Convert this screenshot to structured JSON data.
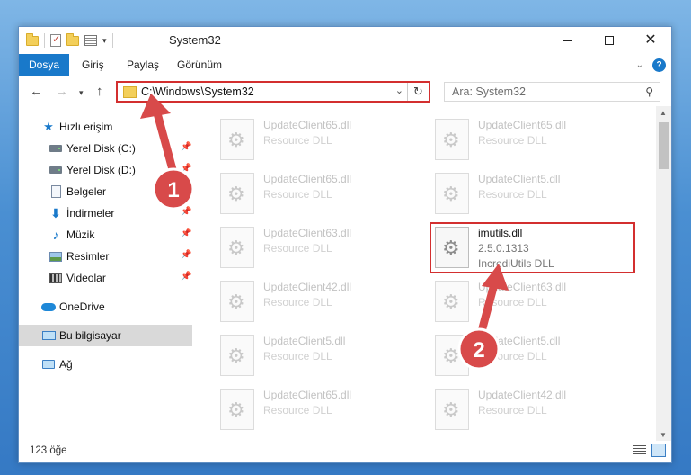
{
  "window": {
    "title": "System32",
    "controls": {
      "minimize": "—",
      "maximize": "☐",
      "close": "✕"
    }
  },
  "ribbon": {
    "tabs": [
      "Dosya",
      "Giriş",
      "Paylaş",
      "Görünüm"
    ],
    "help": "?"
  },
  "nav": {
    "address": "C:\\Windows\\System32",
    "search_placeholder": "Ara: System32"
  },
  "sidebar": {
    "items": [
      {
        "label": "Hızlı erişim",
        "icon": "star-icon"
      },
      {
        "label": "Yerel Disk (C:)",
        "icon": "drive-icon",
        "pinned": true
      },
      {
        "label": "Yerel Disk (D:)",
        "icon": "drive-icon",
        "pinned": true
      },
      {
        "label": "Belgeler",
        "icon": "documents-icon",
        "pinned": true
      },
      {
        "label": "İndirmeler",
        "icon": "downloads-icon",
        "pinned": true
      },
      {
        "label": "Müzik",
        "icon": "music-icon",
        "pinned": true
      },
      {
        "label": "Resimler",
        "icon": "pictures-icon",
        "pinned": true
      },
      {
        "label": "Videolar",
        "icon": "videos-icon",
        "pinned": true
      },
      {
        "label": "OneDrive",
        "icon": "cloud-icon"
      },
      {
        "label": "Bu bilgisayar",
        "icon": "computer-icon",
        "selected": true
      },
      {
        "label": "Ağ",
        "icon": "network-icon"
      }
    ]
  },
  "files": {
    "left": [
      {
        "name": "UpdateClient65.dll",
        "type": "Resource DLL"
      },
      {
        "name": "UpdateClient65.dll",
        "type": "Resource DLL"
      },
      {
        "name": "UpdateClient63.dll",
        "type": "Resource DLL"
      },
      {
        "name": "UpdateClient42.dll",
        "type": "Resource DLL"
      },
      {
        "name": "UpdateClient5.dll",
        "type": "Resource DLL"
      },
      {
        "name": "UpdateClient65.dll",
        "type": "Resource DLL"
      }
    ],
    "right": [
      {
        "name": "UpdateClient65.dll",
        "type": "Resource DLL"
      },
      {
        "name": "UpdateClient5.dll",
        "type": "Resource DLL"
      },
      {
        "name": "UpdateClient63.dll",
        "type": "Resource DLL"
      },
      {
        "name": "UpdateClient5.dll",
        "type": "Resource DLL"
      },
      {
        "name": "UpdateClient42.dll",
        "type": "Resource DLL"
      }
    ],
    "highlighted": {
      "name": "imutils.dll",
      "version": "2.5.0.1313",
      "description": "IncrediUtils DLL"
    }
  },
  "status": {
    "item_count": "123 öğe"
  },
  "annotations": {
    "step1": "1",
    "step2": "2",
    "color": "#d84a4a"
  }
}
